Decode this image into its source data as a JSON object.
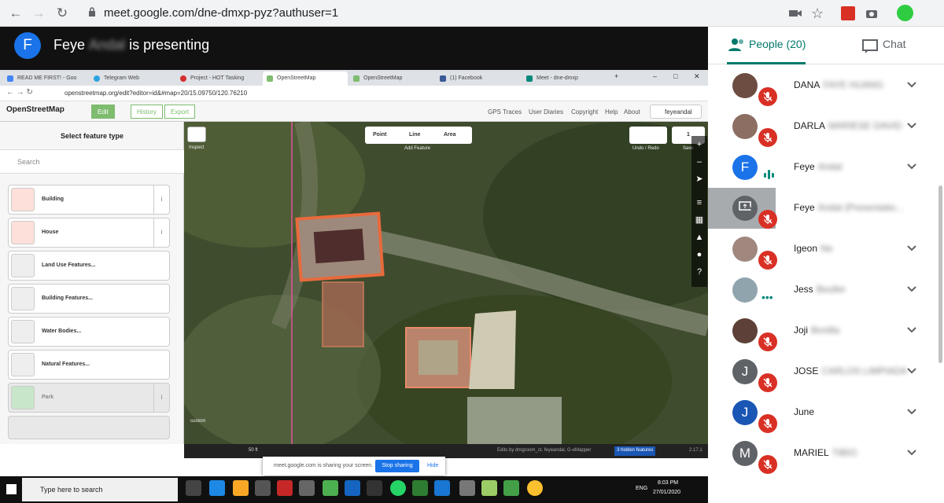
{
  "browser": {
    "url": "meet.google.com/dne-dmxp-pyz?authuser=1",
    "back_icon": "arrow-left-icon",
    "forward_icon": "arrow-right-icon",
    "reload_icon": "reload-icon"
  },
  "presenter": {
    "initial": "F",
    "name": "Feye",
    "name_hidden": "Andal",
    "status": "is presenting"
  },
  "shared_browser": {
    "tabs": [
      {
        "label": "READ ME FIRST! - Goo"
      },
      {
        "label": "Telegram Web"
      },
      {
        "label": "Project - HOT Tasking"
      },
      {
        "label": "OpenStreetMap"
      },
      {
        "label": "OpenStreetMap"
      },
      {
        "label": "(1) Facebook"
      },
      {
        "label": "Meet - dne-dmxp"
      }
    ],
    "url": "openstreetmap.org/edit?editor=id&#map=20/15.09750/120.76210",
    "osm": {
      "logo": "OpenStreetMap",
      "edit": "Edit",
      "history": "History",
      "export": "Export",
      "links": [
        "GPS Traces",
        "User Diaries",
        "Copyright",
        "Help",
        "About"
      ],
      "user": "feyeandal"
    },
    "sidebar": {
      "title": "Select feature type",
      "search_placeholder": "Search",
      "presets": [
        {
          "label": "Building"
        },
        {
          "label": "House"
        },
        {
          "label": "Land Use Features..."
        },
        {
          "label": "Building Features..."
        },
        {
          "label": "Water Bodies..."
        },
        {
          "label": "Natural Features..."
        },
        {
          "label": "Park"
        }
      ]
    },
    "map": {
      "inspect": "Inspect",
      "point": "Point",
      "line": "Line",
      "area": "Area",
      "add_feature": "Add Feature",
      "undo_redo": "Undo / Redo",
      "save": "Save",
      "save_count": "1",
      "scale": "50 ft",
      "custom": "custom",
      "edits_by": "Edits by dmgroom_ct, feyeandal, G-eMapper",
      "hidden_features": "3 hidden features",
      "version": "2.17.1"
    },
    "sharebar": {
      "message": "meet.google.com is sharing your screen.",
      "stop": "Stop sharing",
      "hide": "Hide"
    },
    "taskbar": {
      "search": "Type here to search",
      "lang": "ENG",
      "time": "8:03 PM",
      "date": "27/01/2020"
    }
  },
  "panel": {
    "people_tab": "People (20)",
    "chat_tab": "Chat",
    "participants": [
      {
        "name": "DANA",
        "hidden": "FAYE HUANG",
        "avatar": "photo",
        "color": "#6d4c41",
        "muted": true
      },
      {
        "name": "DARLA",
        "hidden": "MARIESE DAVID",
        "avatar": "photo",
        "color": "#8d6e63",
        "muted": true
      },
      {
        "name": "Feye",
        "hidden": "Andal",
        "avatar": "F",
        "color": "#1a73e8",
        "muted": false
      },
      {
        "name": "Feye",
        "hidden": "Andal (Presentatio...",
        "avatar": "present",
        "color": "#5f6368",
        "muted": true
      },
      {
        "name": "Igeon",
        "hidden": "Ne",
        "avatar": "photo",
        "color": "#a1887f",
        "muted": true
      },
      {
        "name": "Jess",
        "hidden": "Beuller",
        "avatar": "photo",
        "color": "#90a4ae",
        "muted": false
      },
      {
        "name": "Joji",
        "hidden": "Bonilla",
        "avatar": "photo",
        "color": "#5d4037",
        "muted": true
      },
      {
        "name": "JOSE",
        "hidden": "CARLOS LIMPIADA",
        "avatar": "J",
        "color": "#5f6368",
        "muted": true
      },
      {
        "name": "June",
        "hidden": "",
        "avatar": "J",
        "color": "#1a56b4",
        "muted": true
      },
      {
        "name": "MARIEL",
        "hidden": "TIBIO",
        "avatar": "M",
        "color": "#5f6368",
        "muted": true
      }
    ]
  }
}
